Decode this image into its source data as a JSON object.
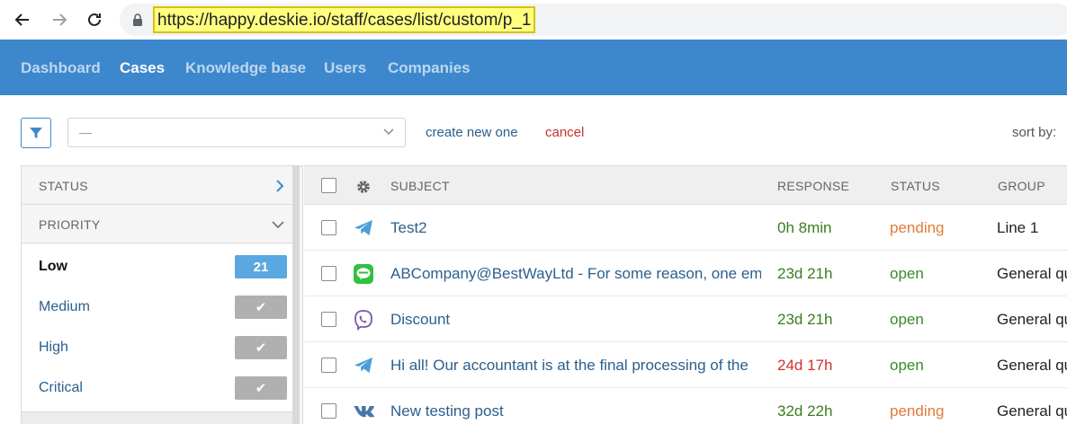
{
  "browser": {
    "url": "https://happy.deskie.io/staff/cases/list/custom/p_1"
  },
  "nav": {
    "items": [
      {
        "label": "Dashboard",
        "active": false
      },
      {
        "label": "Cases",
        "active": true
      },
      {
        "label": "Knowledge base",
        "active": false
      },
      {
        "label": "Users",
        "active": false
      },
      {
        "label": "Companies",
        "active": false
      }
    ]
  },
  "toolbar": {
    "filter_value": "—",
    "create_label": "create new one",
    "cancel_label": "cancel",
    "sort_label": "sort by:"
  },
  "sidebar": {
    "status_label": "STATUS",
    "priority_label": "PRIORITY",
    "priorities": [
      {
        "label": "Low",
        "badge": "21",
        "selected": true
      },
      {
        "label": "Medium",
        "badge": "✔",
        "selected": false
      },
      {
        "label": "High",
        "badge": "✔",
        "selected": false
      },
      {
        "label": "Critical",
        "badge": "✔",
        "selected": false
      }
    ]
  },
  "table": {
    "headers": {
      "subject": "SUBJECT",
      "response": "RESPONSE",
      "status": "STATUS",
      "group": "GROUP"
    },
    "rows": [
      {
        "icon": "telegram-icon",
        "subject": "Test2",
        "response": "0h 8min",
        "response_color": "#3a7d1e",
        "status": "pending",
        "status_color": "#e07b39",
        "group": "Line 1"
      },
      {
        "icon": "line-icon",
        "subject": "ABCompany@BestWayLtd - For some reason, one email",
        "response": "23d 21h",
        "response_color": "#3a7d1e",
        "status": "open",
        "status_color": "#3a8a2a",
        "group": "General query"
      },
      {
        "icon": "viber-icon",
        "subject": "Discount",
        "response": "23d 21h",
        "response_color": "#3a7d1e",
        "status": "open",
        "status_color": "#3a8a2a",
        "group": "General query"
      },
      {
        "icon": "telegram-icon",
        "subject": "Hi all! Our accountant is at the final processing of the",
        "response": "24d 17h",
        "response_color": "#d0312d",
        "status": "open",
        "status_color": "#3a8a2a",
        "group": "General query"
      },
      {
        "icon": "vk-icon",
        "subject": "New testing post",
        "response": "32d 22h",
        "response_color": "#3a7d1e",
        "status": "pending",
        "status_color": "#e07b39",
        "group": "General query"
      }
    ]
  },
  "colors": {
    "accent": "#3d88cc",
    "nav_inactive": "#bcd7f0",
    "count_badge": "#5ba8e0",
    "check_badge": "#b0b0b0"
  }
}
